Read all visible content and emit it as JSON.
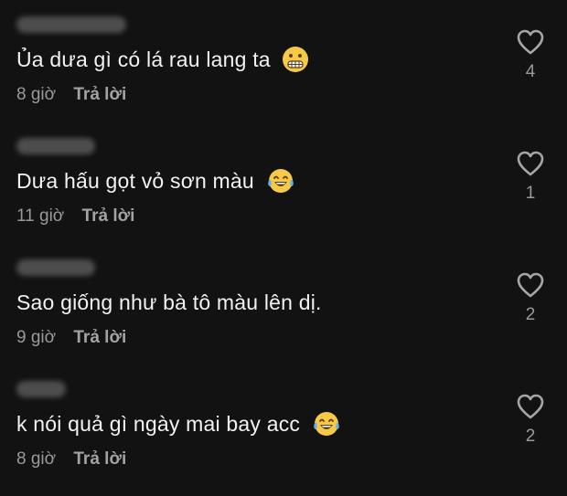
{
  "comments": [
    {
      "text": "Ủa dưa gì có lá rau lang ta",
      "emoji": "grimacing-face-icon",
      "time": "8 giờ",
      "reply": "Trả lời",
      "likes": "4"
    },
    {
      "text": "Dưa hấu gọt vỏ sơn màu",
      "emoji": "tears-of-joy-face-icon",
      "time": "11 giờ",
      "reply": "Trả lời",
      "likes": "1"
    },
    {
      "text": "Sao giống như bà tô màu lên dị.",
      "emoji": "",
      "time": "9 giờ",
      "reply": "Trả lời",
      "likes": "2"
    },
    {
      "text": "k nói quả gì ngày mai bay acc",
      "emoji": "tears-of-joy-face-icon",
      "time": "8 giờ",
      "reply": "Trả lời",
      "likes": "2"
    }
  ],
  "colors": {
    "background": "#121212",
    "text": "#f2f2f2",
    "muted": "#9a9a9a"
  }
}
